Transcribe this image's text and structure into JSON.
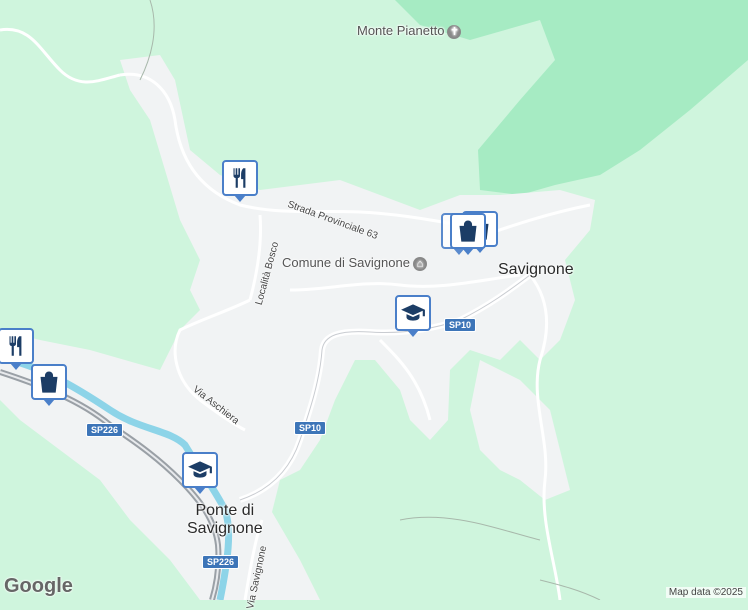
{
  "map": {
    "town_labels": {
      "savignone": "Savignone",
      "ponte_line1": "Ponte di",
      "ponte_line2": "Savignone"
    },
    "poi_labels": {
      "monte_pianetto": "Monte Pianetto",
      "comune": "Comune di Savignone"
    },
    "road_labels": {
      "strada_provinciale": "Strada Provinciale 63",
      "localita_bosco": "Località Bosco",
      "via_aschiera": "Via Aschiera",
      "via_savignone": "Via Savignone"
    },
    "shields": {
      "sp10_a": "SP10",
      "sp10_b": "SP10",
      "sp226_a": "SP226",
      "sp226_b": "SP226"
    },
    "markers": [
      {
        "type": "restaurant",
        "icon": "fork-knife-icon"
      },
      {
        "type": "shopping",
        "icon": "shopping-bag-icon"
      },
      {
        "type": "school",
        "icon": "graduation-cap-icon"
      },
      {
        "type": "restaurant",
        "icon": "fork-knife-icon"
      },
      {
        "type": "shopping",
        "icon": "shopping-bag-icon"
      },
      {
        "type": "school",
        "icon": "graduation-cap-icon"
      }
    ],
    "colors": {
      "forest_green": "#cff5dd",
      "dark_green": "#a6ebc3",
      "urban": "#f1f3f4",
      "river": "#8dd4e8",
      "highway": "#9aa0a6",
      "marker_border": "#4a7fc9"
    }
  },
  "footer": {
    "logo": "Google",
    "attribution": "Map data ©2025"
  }
}
